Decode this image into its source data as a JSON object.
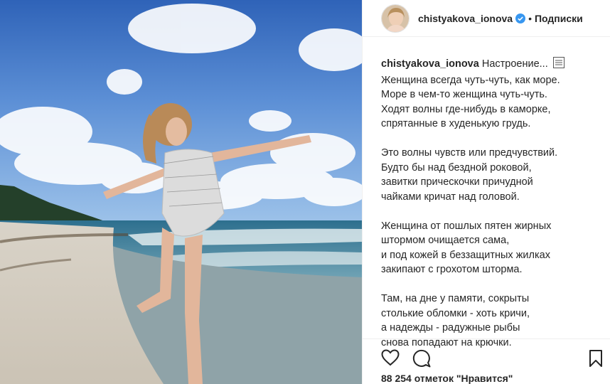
{
  "post": {
    "username": "chistyakova_ionova",
    "follow_status": "Подписки",
    "dot": "•",
    "caption_first": "Настроение...",
    "stanzas": [
      [
        "Женщина всегда чуть-чуть, как море.",
        "Море в чем-то женщина чуть-чуть.",
        "Ходят волны где-нибудь в каморке,",
        "спрятанные в худенькую грудь."
      ],
      [
        "Это волны чувств или предчувствий.",
        "Будто бы над бездной роковой,",
        "завитки прическочки причудной",
        "чайками кричат над головой."
      ],
      [
        "Женщина от пошлых пятен жирных",
        "штормом очищается сама,",
        "и под кожей в беззащитных жилках",
        "закипают с грохотом шторма."
      ],
      [
        "Там, на дне у памяти, сокрыты",
        "столькие обломки - хоть кричи,",
        "а надежды - радужные рыбы",
        "снова попадают на крючки."
      ]
    ],
    "likes": "88 254 отметок \"Нравится\""
  },
  "icons": {
    "verified": "verified-badge-icon",
    "like": "heart-icon",
    "comment": "comment-icon",
    "save": "bookmark-icon",
    "more": "more-icon"
  },
  "colors": {
    "verified_blue": "#3897f0",
    "text": "#262626"
  }
}
